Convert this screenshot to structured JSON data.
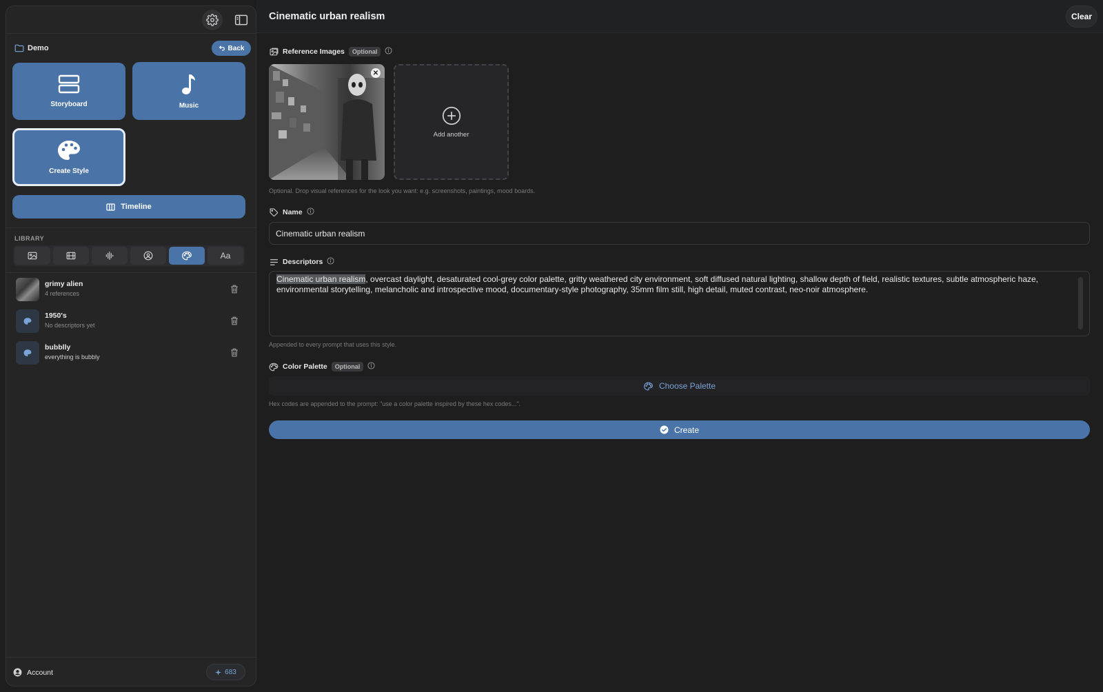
{
  "sidebar": {
    "project_name": "Demo",
    "back_label": "Back",
    "tiles": [
      {
        "label": "Storyboard",
        "icon": "storyboard-icon"
      },
      {
        "label": "Music",
        "icon": "music-note-icon"
      },
      {
        "label": "Create Style",
        "icon": "palette-icon"
      }
    ],
    "timeline_label": "Timeline",
    "library_label": "LIBRARY",
    "library_tabs": [
      {
        "icon": "image-icon"
      },
      {
        "icon": "film-icon"
      },
      {
        "icon": "audio-waveform-icon"
      },
      {
        "icon": "person-icon"
      },
      {
        "icon": "palette-icon",
        "active": true
      },
      {
        "label": "Aa",
        "icon": "text-icon"
      }
    ],
    "library_items": [
      {
        "title": "grimy alien",
        "subtitle": "4 references"
      },
      {
        "title": "1950's",
        "subtitle": "No descriptors yet"
      },
      {
        "title": "bubblly",
        "subtitle": "everything is bubbly"
      }
    ],
    "account_label": "Account",
    "credits": "683"
  },
  "header": {
    "title": "Cinematic urban realism",
    "clear_label": "Clear"
  },
  "reference_images": {
    "label": "Reference Images",
    "badge": "Optional",
    "add_label": "Add another",
    "helper": "Optional. Drop visual references for the look you want: e.g. screenshots, paintings, mood boards."
  },
  "name": {
    "label": "Name",
    "value": "Cinematic urban realism"
  },
  "descriptors": {
    "label": "Descriptors",
    "selected": "Cinematic urban realism",
    "value_rest": ", overcast daylight, desaturated cool-grey color palette, gritty weathered city environment, soft diffused natural lighting, shallow depth of field, realistic textures, subtle atmospheric haze, environmental storytelling, melancholic and introspective mood, documentary-style photography, 35mm film still, high detail, muted contrast, neo-noir atmosphere.",
    "helper": "Appended to every prompt that uses this style."
  },
  "color_palette": {
    "label": "Color Palette",
    "badge": "Optional",
    "button_label": "Choose Palette",
    "helper": "Hex codes are appended to the prompt: \"use a color palette inspired by these hex codes...\"."
  },
  "create_label": "Create",
  "colors": {
    "accent": "#4a74a8",
    "accent_text": "#7aa4d8",
    "background": "#1e1e1f",
    "panel": "#252526"
  }
}
